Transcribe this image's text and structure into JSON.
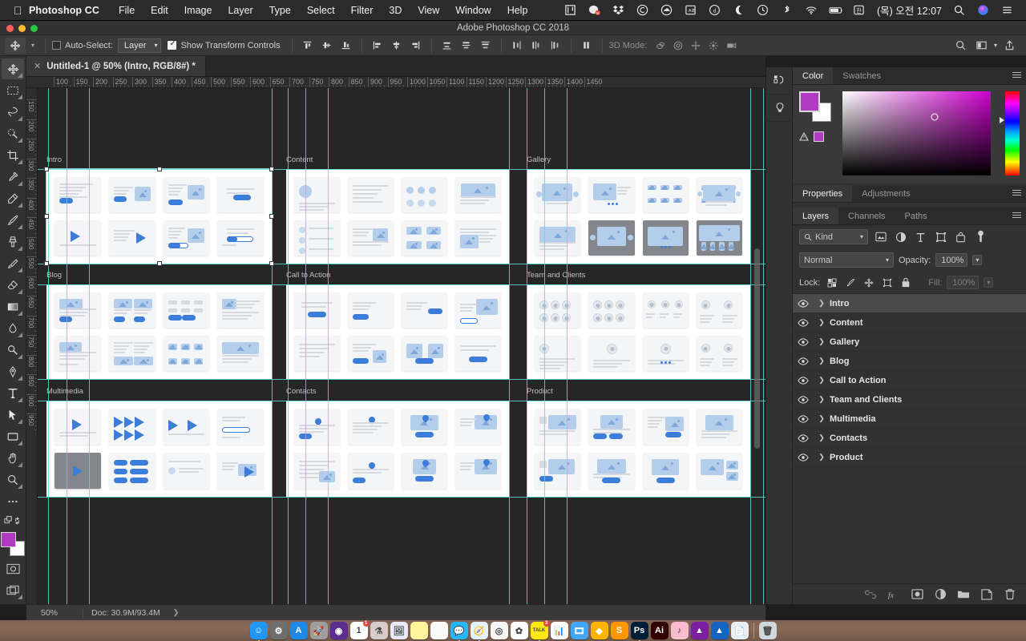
{
  "macbar": {
    "apple_icon": "apple-icon",
    "app_name": "Photoshop CC",
    "menus": [
      "File",
      "Edit",
      "Image",
      "Layer",
      "Type",
      "Select",
      "Filter",
      "3D",
      "View",
      "Window",
      "Help"
    ],
    "status_icons": [
      "notability-icon",
      "messenger-icon",
      "dropbox-icon",
      "creative-cloud-icon",
      "cloud-icon",
      "dictionary-icon",
      "d-circle-icon",
      "moon-icon",
      "time-machine-icon",
      "bluetooth-icon",
      "wifi-icon",
      "battery-icon",
      "input-source-korean-icon"
    ],
    "input_source": "한",
    "clock": "(목) 오전 12:07",
    "search_icon": "spotlight-search-icon",
    "siri_icon": "siri-icon",
    "control_center_icon": "notification-center-icon"
  },
  "window": {
    "title": "Adobe Photoshop CC 2018",
    "traffic": {
      "close": "#ff5f57",
      "minimize": "#febc2e",
      "zoom": "#28c840"
    }
  },
  "options_bar": {
    "tool_icon": "move-tool-icon",
    "preset_chevron": "chevron-down-icon",
    "auto_select_checked": false,
    "auto_select_label": "Auto-Select:",
    "auto_select_value": "Layer",
    "show_transform_checked": true,
    "show_transform_label": "Show Transform Controls",
    "align_icons": [
      "align-top-edges-icon",
      "align-vertical-centers-icon",
      "align-bottom-edges-icon",
      "align-left-edges-icon",
      "align-horizontal-centers-icon",
      "align-right-edges-icon"
    ],
    "distribute_icons": [
      "distribute-top-edges-icon",
      "distribute-vertical-centers-icon",
      "distribute-bottom-edges-icon",
      "distribute-left-edges-icon",
      "distribute-horizontal-centers-icon",
      "distribute-right-edges-icon"
    ],
    "more_icon": "align-more-icon",
    "mode_3d_label": "3D Mode:",
    "mode_3d_icons": [
      "rotate-3d-icon",
      "roll-3d-icon",
      "pan-3d-icon",
      "slide-3d-icon",
      "scale-3d-camera-icon"
    ],
    "right_icons": [
      "search-icon",
      "workspace-icon",
      "chevron-down-icon",
      "share-icon"
    ]
  },
  "toolbar": {
    "tools": [
      {
        "name": "move-tool",
        "active": true
      },
      {
        "name": "rectangular-marquee-tool",
        "active": false
      },
      {
        "name": "lasso-tool",
        "active": false
      },
      {
        "name": "quick-selection-tool",
        "active": false
      },
      {
        "name": "crop-tool",
        "active": false
      },
      {
        "name": "eyedropper-tool",
        "active": false
      },
      {
        "name": "spot-healing-brush-tool",
        "active": false
      },
      {
        "name": "brush-tool",
        "active": false
      },
      {
        "name": "clone-stamp-tool",
        "active": false
      },
      {
        "name": "history-brush-tool",
        "active": false
      },
      {
        "name": "eraser-tool",
        "active": false
      },
      {
        "name": "gradient-tool",
        "active": false
      },
      {
        "name": "blur-tool",
        "active": false
      },
      {
        "name": "dodge-tool",
        "active": false
      },
      {
        "name": "pen-tool",
        "active": false
      },
      {
        "name": "type-tool",
        "active": false
      },
      {
        "name": "path-selection-tool",
        "active": false
      },
      {
        "name": "rectangle-tool",
        "active": false
      },
      {
        "name": "hand-tool",
        "active": false
      },
      {
        "name": "zoom-tool",
        "active": false
      },
      {
        "name": "edit-toolbar-tool",
        "active": false
      }
    ],
    "foreground_color": "#b03ac2",
    "background_color": "#ffffff",
    "quick_mask_icon": "quick-mask-icon",
    "screen_mode_icon": "screen-mode-icon",
    "swap_icon": "swap-colors-icon",
    "default_icon": "default-colors-icon"
  },
  "document": {
    "tab_title": "Untitled-1 @ 50% (Intro, RGB/8#) *",
    "close_icon": "close-icon",
    "ruler_unit_step": 50,
    "ruler_h_labels": [
      100,
      150,
      200,
      250,
      300,
      350,
      400,
      450,
      500,
      550,
      600,
      650,
      700,
      750,
      800,
      850,
      900,
      950,
      1000,
      1050,
      1100,
      1150,
      1200,
      1250,
      1300,
      1350,
      1400,
      1450
    ],
    "ruler_v_labels": [
      150,
      200,
      250,
      300,
      350,
      400,
      450,
      500,
      550,
      600,
      650,
      700,
      750,
      800,
      850,
      900,
      950
    ],
    "artboards": [
      {
        "label": "Intro",
        "row": 0,
        "col": 0
      },
      {
        "label": "Content",
        "row": 0,
        "col": 1
      },
      {
        "label": "Gallery",
        "row": 0,
        "col": 2
      },
      {
        "label": "Blog",
        "row": 1,
        "col": 0
      },
      {
        "label": "Call to Action",
        "row": 1,
        "col": 1
      },
      {
        "label": "Team and Clients",
        "row": 1,
        "col": 2
      },
      {
        "label": "Multimedia",
        "row": 2,
        "col": 0
      },
      {
        "label": "Contacts",
        "row": 2,
        "col": 1
      },
      {
        "label": "Product",
        "row": 2,
        "col": 2
      }
    ],
    "selected_artboard": "Intro"
  },
  "status_bar": {
    "zoom": "50%",
    "doc_label": "Doc: 30.9M/93.4M",
    "expand_icon": "chevron-right-icon"
  },
  "right_rail": {
    "buttons": [
      "libraries-icon",
      "learn-bulb-icon"
    ],
    "collapse_icon": "collapse-panels-icon",
    "eye_icon": "preview-eye-icon"
  },
  "color_panel": {
    "tabs": [
      {
        "label": "Color",
        "active": true
      },
      {
        "label": "Swatches",
        "active": false
      }
    ],
    "menu_icon": "panel-menu-icon",
    "foreground": "#b03ac2",
    "background": "#ffffff",
    "out_of_gamut_icon": "gamut-warning-icon",
    "web_safe_swatch": "#b03ac2"
  },
  "properties_panel": {
    "tabs": [
      {
        "label": "Properties",
        "active": true
      },
      {
        "label": "Adjustments",
        "active": false
      }
    ],
    "menu_icon": "panel-menu-icon"
  },
  "layers_panel": {
    "tabs": [
      {
        "label": "Layers",
        "active": true
      },
      {
        "label": "Channels",
        "active": false
      },
      {
        "label": "Paths",
        "active": false
      }
    ],
    "menu_icon": "panel-menu-icon",
    "filter": {
      "search_icon": "search-icon",
      "kind_label": "Kind",
      "chevron": "chevron-down-icon",
      "type_icons": [
        "filter-pixel-icon",
        "filter-adjustment-icon",
        "filter-type-icon",
        "filter-shape-icon",
        "filter-smart-object-icon"
      ],
      "toggle_icon": "filter-toggle-switch"
    },
    "blend_mode": "Normal",
    "opacity_label": "Opacity:",
    "opacity_value": "100%",
    "lock_label": "Lock:",
    "lock_icons": [
      "lock-transparent-pixels-icon",
      "lock-image-pixels-icon",
      "lock-position-icon",
      "lock-artboard-nesting-icon",
      "lock-all-icon"
    ],
    "fill_label": "Fill:",
    "fill_value": "100%",
    "layers": [
      {
        "name": "Intro",
        "visible": true,
        "selected": true,
        "expandable": true
      },
      {
        "name": "Content",
        "visible": true,
        "selected": false,
        "expandable": true
      },
      {
        "name": "Gallery",
        "visible": true,
        "selected": false,
        "expandable": true
      },
      {
        "name": "Blog",
        "visible": true,
        "selected": false,
        "expandable": true
      },
      {
        "name": "Call to Action",
        "visible": true,
        "selected": false,
        "expandable": true
      },
      {
        "name": "Team and Clients",
        "visible": true,
        "selected": false,
        "expandable": true
      },
      {
        "name": "Multimedia",
        "visible": true,
        "selected": false,
        "expandable": true
      },
      {
        "name": "Contacts",
        "visible": true,
        "selected": false,
        "expandable": true
      },
      {
        "name": "Product",
        "visible": true,
        "selected": false,
        "expandable": true
      }
    ],
    "footer_icons": [
      "link-layers-icon",
      "layer-style-fx-icon",
      "add-layer-mask-icon",
      "new-adjustment-layer-icon",
      "new-group-icon",
      "new-layer-icon",
      "delete-layer-icon"
    ]
  },
  "dock": {
    "items": [
      {
        "name": "finder",
        "color": "#2196f3",
        "glyph": "☺",
        "running": true
      },
      {
        "name": "system-preferences",
        "color": "#6e6e6e",
        "glyph": "⚙",
        "running": false
      },
      {
        "name": "app-store",
        "color": "#1e88e5",
        "glyph": "A",
        "running": false
      },
      {
        "name": "launchpad",
        "color": "#9e9e9e",
        "glyph": "🚀",
        "running": false
      },
      {
        "name": "siri",
        "color": "#5c2d91",
        "glyph": "◉",
        "running": false
      },
      {
        "name": "calendar",
        "color": "#ffffff",
        "glyph": "1",
        "running": false,
        "badge": "1"
      },
      {
        "name": "automator",
        "color": "#d7ccc8",
        "glyph": "⚗",
        "running": false
      },
      {
        "name": "preview",
        "color": "#e8eaf6",
        "glyph": "🖼",
        "running": false
      },
      {
        "name": "notes",
        "color": "#fff59d",
        "glyph": "",
        "running": false
      },
      {
        "name": "pages",
        "color": "#fafafa",
        "glyph": "",
        "running": false
      },
      {
        "name": "messages",
        "color": "#29b6f6",
        "glyph": "💬",
        "running": true
      },
      {
        "name": "safari",
        "color": "#e3f2fd",
        "glyph": "🧭",
        "running": true
      },
      {
        "name": "google-chrome",
        "color": "#f5f5f5",
        "glyph": "◎",
        "running": false
      },
      {
        "name": "photos",
        "color": "#fff",
        "glyph": "✿",
        "running": false
      },
      {
        "name": "kakaotalk",
        "color": "#ffe812",
        "glyph": "TALK",
        "running": true,
        "badge": "3"
      },
      {
        "name": "numbers",
        "color": "#ffffff",
        "glyph": "📊",
        "running": false
      },
      {
        "name": "keynote",
        "color": "#42a5f5",
        "glyph": "🎞",
        "running": false
      },
      {
        "name": "sketch",
        "color": "#fdb300",
        "glyph": "◆",
        "running": false
      },
      {
        "name": "sublime-text",
        "color": "#ff9800",
        "glyph": "S",
        "running": false
      },
      {
        "name": "photoshop",
        "color": "#001e36",
        "glyph": "Ps",
        "running": true
      },
      {
        "name": "illustrator",
        "color": "#330000",
        "glyph": "Ai",
        "running": false
      },
      {
        "name": "itunes",
        "color": "#f8bbd0",
        "glyph": "♪",
        "running": false
      },
      {
        "name": "affinity-photo",
        "color": "#7b1fa2",
        "glyph": "▲",
        "running": false
      },
      {
        "name": "affinity-designer",
        "color": "#1565c0",
        "glyph": "▲",
        "running": false
      },
      {
        "name": "downloads-stack",
        "color": "#eceff1",
        "glyph": "📄",
        "running": false
      },
      {
        "name": "trash",
        "color": "#cfd8dc",
        "glyph": "🗑",
        "running": false
      }
    ]
  },
  "colors": {
    "accent_blue": "#3b7dd8",
    "guide_cyan": "#5fd8d8",
    "panel_bg": "#323232",
    "canvas_bg": "#262626",
    "foreground_swatch": "#b03ac2"
  }
}
